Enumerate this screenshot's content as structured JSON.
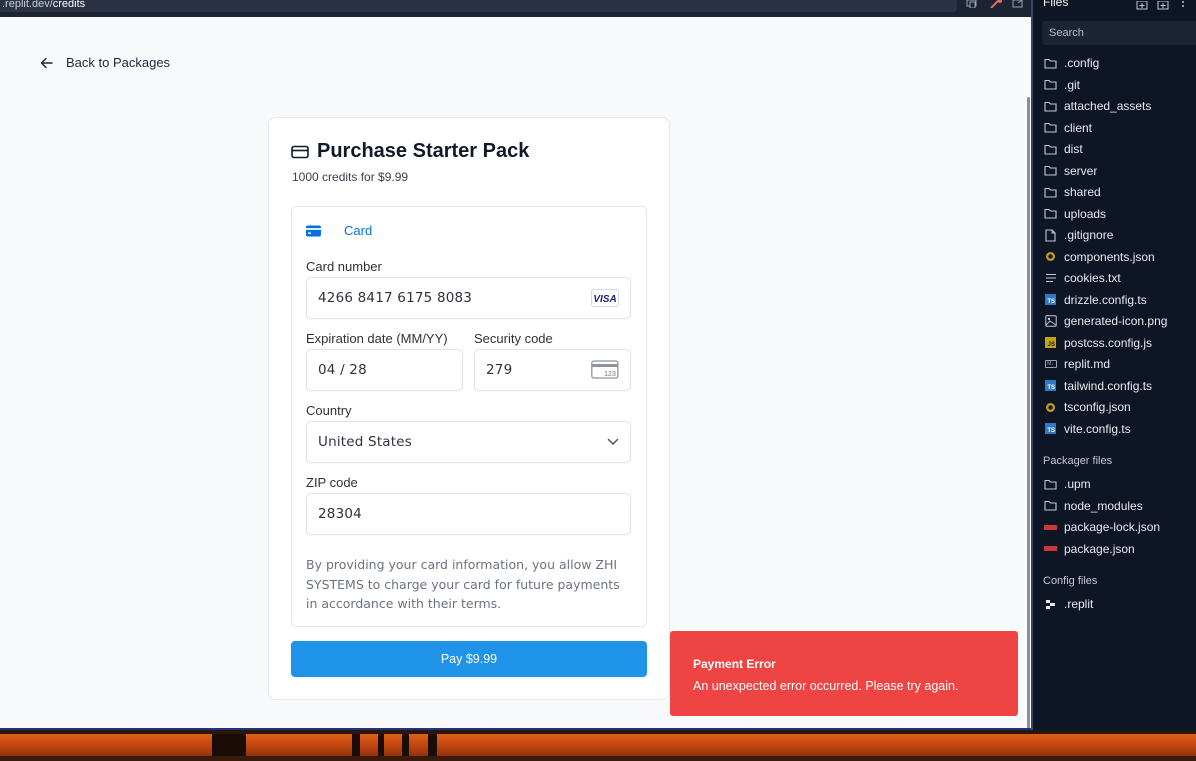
{
  "browser": {
    "url_domain": ".replit.dev/",
    "url_path": "credits"
  },
  "page": {
    "back_label": "Back to Packages",
    "title": "Purchase Starter Pack",
    "subtitle": "1000 credits for $9.99",
    "payment_tab_label": "Card",
    "card_number_label": "Card number",
    "card_number_value": "4266 8417 6175 8083",
    "card_brand": "VISA",
    "expiry_label": "Expiration date (MM/YY)",
    "expiry_value": "04 / 28",
    "cvc_label": "Security code",
    "cvc_value": "279",
    "cvc_icon_text": "123",
    "country_label": "Country",
    "country_value": "United States",
    "zip_label": "ZIP code",
    "zip_value": "28304",
    "disclaimer": "By providing your card information, you allow ZHI SYSTEMS to charge your card for future payments in accordance with their terms.",
    "pay_button_label": "Pay $9.99"
  },
  "toast": {
    "title": "Payment Error",
    "message": "An unexpected error occurred. Please try again.",
    "color": "#ef4444"
  },
  "files_pane": {
    "title": "Files",
    "search_placeholder": "Search",
    "items": [
      {
        "name": ".config",
        "icon": "folder-icon"
      },
      {
        "name": ".git",
        "icon": "folder-icon"
      },
      {
        "name": "attached_assets",
        "icon": "folder-icon"
      },
      {
        "name": "client",
        "icon": "folder-icon"
      },
      {
        "name": "dist",
        "icon": "folder-icon"
      },
      {
        "name": "server",
        "icon": "folder-icon"
      },
      {
        "name": "shared",
        "icon": "folder-icon"
      },
      {
        "name": "uploads",
        "icon": "folder-icon"
      },
      {
        "name": ".gitignore",
        "icon": "file-icon"
      },
      {
        "name": "components.json",
        "icon": "json-icon"
      },
      {
        "name": "cookies.txt",
        "icon": "text-file-icon"
      },
      {
        "name": "drizzle.config.ts",
        "icon": "typescript-icon"
      },
      {
        "name": "generated-icon.png",
        "icon": "image-icon"
      },
      {
        "name": "postcss.config.js",
        "icon": "javascript-icon"
      },
      {
        "name": "replit.md",
        "icon": "markdown-icon"
      },
      {
        "name": "tailwind.config.ts",
        "icon": "typescript-icon"
      },
      {
        "name": "tsconfig.json",
        "icon": "json-icon"
      },
      {
        "name": "vite.config.ts",
        "icon": "typescript-icon"
      }
    ],
    "packager_section_title": "Packager files",
    "packager_items": [
      {
        "name": ".upm",
        "icon": "folder-icon"
      },
      {
        "name": "node_modules",
        "icon": "folder-icon"
      },
      {
        "name": "package-lock.json",
        "icon": "npm-icon"
      },
      {
        "name": "package.json",
        "icon": "npm-icon"
      }
    ],
    "config_section_title": "Config files",
    "config_items": [
      {
        "name": ".replit",
        "icon": "replit-icon"
      }
    ]
  },
  "colors": {
    "accent": "#1f93e8",
    "stripe_blue": "#0570de",
    "sidebar_bg": "#0e1525"
  }
}
